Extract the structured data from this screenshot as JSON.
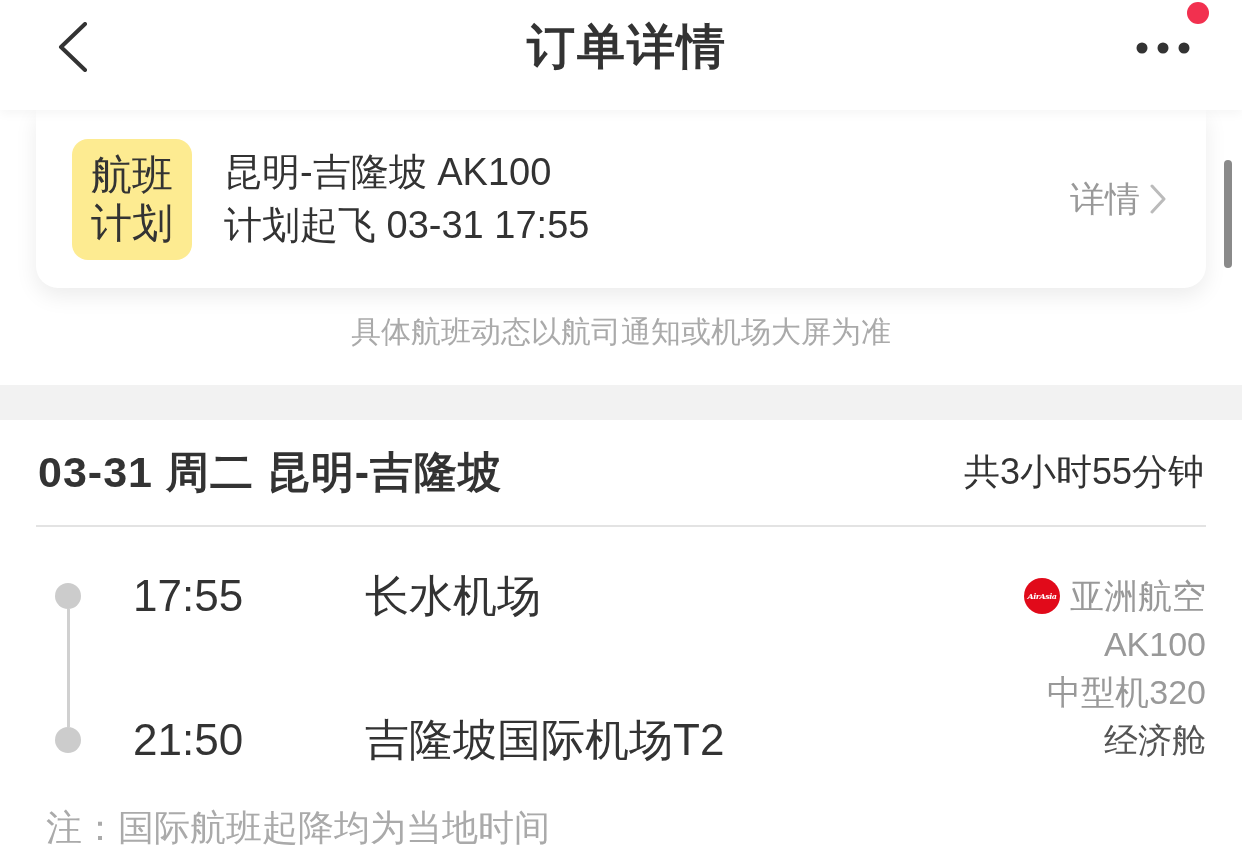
{
  "header": {
    "title": "订单详情",
    "notification": true
  },
  "flight_plan_card": {
    "badge_lines": [
      "航班",
      "计划"
    ],
    "route": "昆明-吉隆坡 AK100",
    "departure": "计划起飞 03-31 17:55",
    "link": "详情"
  },
  "disclaimer": "具体航班动态以航司通知或机场大屏为准",
  "segment": {
    "title": "03-31 周二 昆明-吉隆坡",
    "duration": "共3小时55分钟",
    "stops": [
      {
        "time": "17:55",
        "airport": "长水机场"
      },
      {
        "time": "21:50",
        "airport": "吉隆坡国际机场T2"
      }
    ],
    "airline": {
      "logo_text": "AirAsia",
      "name": "亚洲航空",
      "flight_no": "AK100",
      "aircraft": "中型机320",
      "cabin": "经济舱"
    }
  },
  "note": "注：国际航班起降均为当地时间"
}
